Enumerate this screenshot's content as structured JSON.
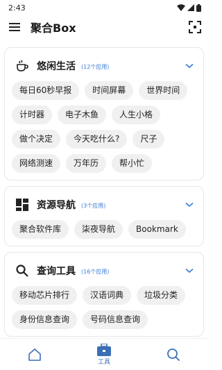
{
  "status_bar": {
    "time": "2:43"
  },
  "app_bar": {
    "title": "聚合Box"
  },
  "sections": [
    {
      "title": "悠闲生活",
      "count": "(12个应用)",
      "items": [
        "每日60秒早报",
        "时间屏幕",
        "世界时间",
        "计时器",
        "电子木鱼",
        "人生小格",
        "做个决定",
        "今天吃什么?",
        "尺子",
        "网络测速",
        "万年历",
        "帮小忙"
      ]
    },
    {
      "title": "资源导航",
      "count": "(3个应用)",
      "items": [
        "聚合软件库",
        "柒夜导航",
        "Bookmark"
      ]
    },
    {
      "title": "查询工具",
      "count": "(16个应用)",
      "items": [
        "移动芯片排行",
        "汉语词典",
        "垃圾分类",
        "身份信息查询",
        "号码信息查询"
      ]
    }
  ],
  "bottom_nav": {
    "tools_label": "工具"
  },
  "colors": {
    "accent": "#3a7bd5",
    "chip_bg": "#f0f0f0"
  }
}
